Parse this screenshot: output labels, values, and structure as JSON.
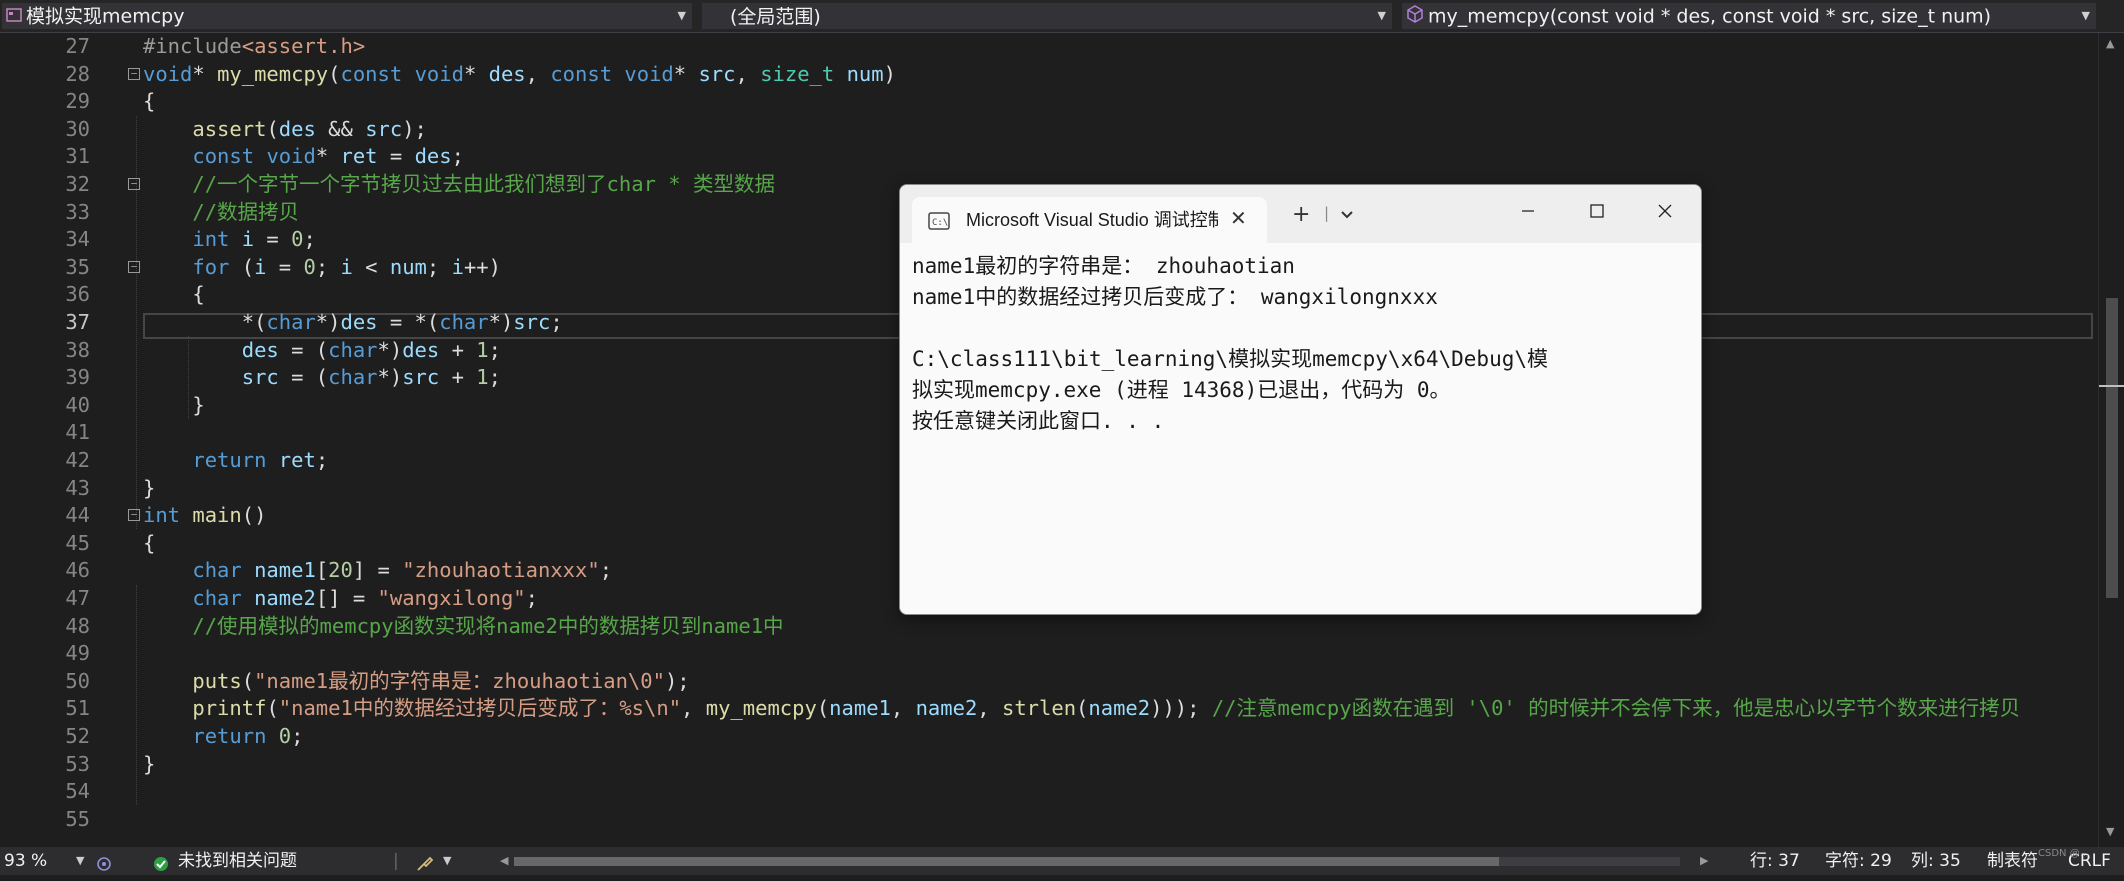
{
  "navbar": {
    "project": "模拟实现memcpy",
    "scope": "(全局范围)",
    "member": "my_memcpy(const void * des, const void * src, size_t num)"
  },
  "editor": {
    "line_numbers": [
      "27",
      "28",
      "29",
      "30",
      "31",
      "32",
      "33",
      "34",
      "35",
      "36",
      "37",
      "38",
      "39",
      "40",
      "41",
      "42",
      "43",
      "44",
      "45",
      "46",
      "47",
      "48",
      "49",
      "50",
      "51",
      "52",
      "53",
      "54",
      "55"
    ],
    "current_line": "37"
  },
  "console": {
    "tab_title": "Microsoft Visual Studio 调试控制台",
    "output": [
      "name1最初的字符串是： zhouhaotian",
      "name1中的数据经过拷贝后变成了： wangxilongnxxx",
      "",
      "C:\\class111\\bit_learning\\模拟实现memcpy\\x64\\Debug\\模",
      "拟实现memcpy.exe (进程 14368)已退出，代码为 0。",
      "按任意键关闭此窗口. . ."
    ]
  },
  "statusbar": {
    "zoom": "93 %",
    "issues": "未找到相关问题",
    "line": "行: 37",
    "char": "字符: 29",
    "col": "列: 35",
    "indent": "制表符",
    "eol": "CRLF",
    "watermark": "CSDN @..."
  },
  "colors": {
    "editor_bg": "#1e1e1e",
    "keyword": "#569cd6",
    "type": "#4ec9b0",
    "function": "#dcdcaa",
    "variable": "#9cdcfe",
    "string": "#d69d85",
    "comment": "#57a64a",
    "number": "#b5cea8"
  },
  "icons": [
    "project-icon",
    "member-icon",
    "paintbrush-icon",
    "ok-check-icon",
    "terminal-icon",
    "close-icon",
    "plus-icon",
    "chevron-down-icon",
    "minimize-icon",
    "maximize-icon"
  ]
}
